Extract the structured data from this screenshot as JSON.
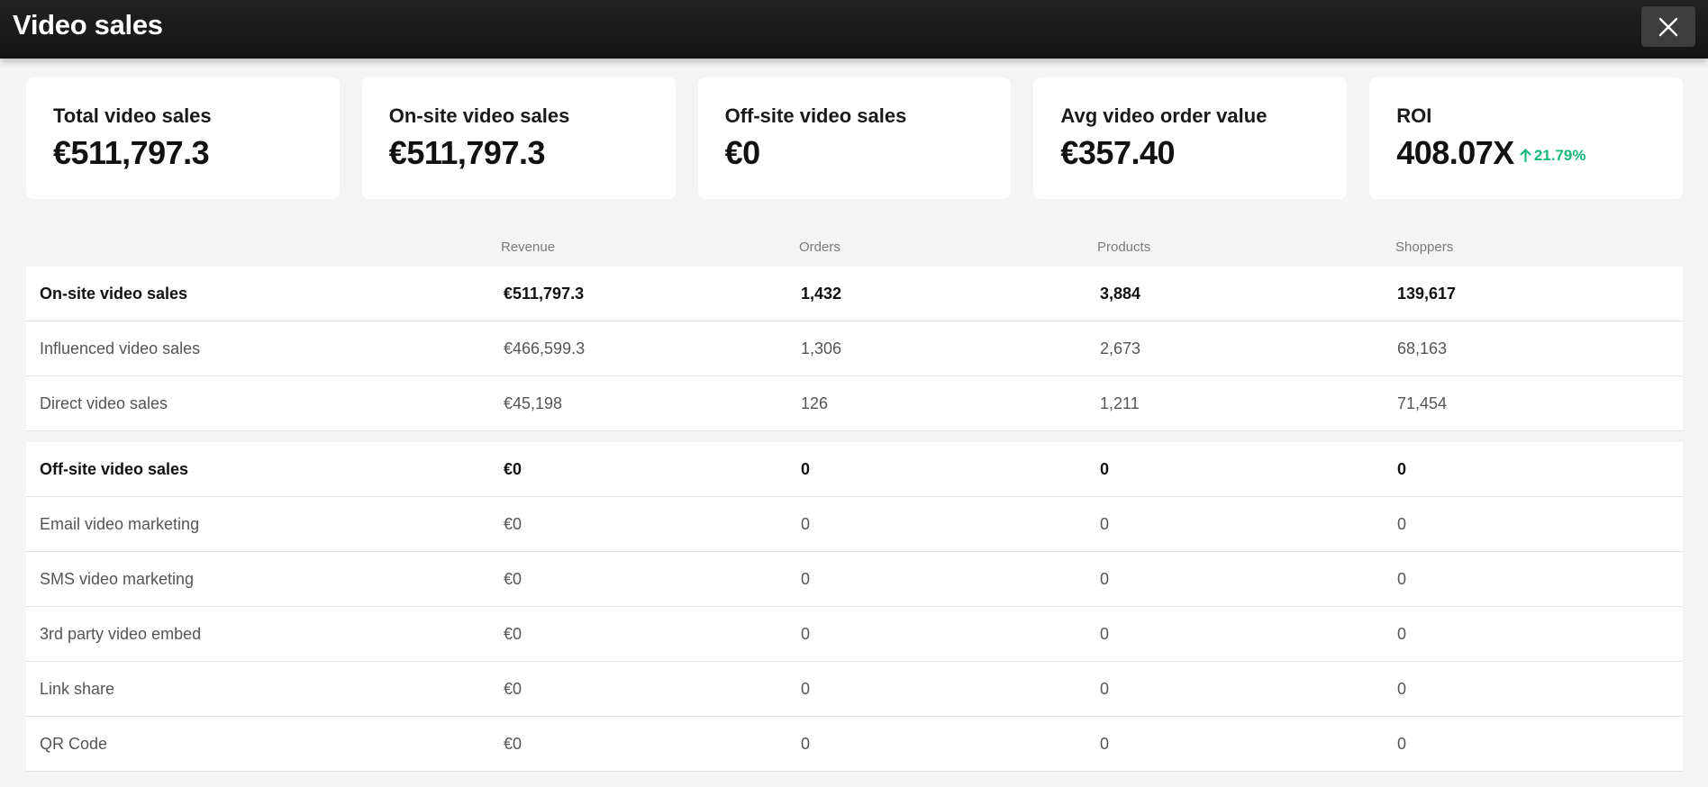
{
  "header": {
    "title": "Video sales"
  },
  "kpis": [
    {
      "label": "Total video sales",
      "value": "€511,797.3"
    },
    {
      "label": "On-site video sales",
      "value": "€511,797.3"
    },
    {
      "label": "Off-site video sales",
      "value": "€0"
    },
    {
      "label": "Avg video order value",
      "value": "€357.40"
    },
    {
      "label": "ROI",
      "value": "408.07X",
      "trend": "21.79%",
      "trend_direction": "up",
      "trend_color": "#1ab87a"
    }
  ],
  "table": {
    "columns": [
      "Revenue",
      "Orders",
      "Products",
      "Shoppers"
    ],
    "onsite": [
      {
        "name": "On-site video sales",
        "revenue": "€511,797.3",
        "orders": "1,432",
        "products": "3,884",
        "shoppers": "139,617"
      },
      {
        "name": "Influenced video sales",
        "revenue": "€466,599.3",
        "orders": "1,306",
        "products": "2,673",
        "shoppers": "68,163"
      },
      {
        "name": "Direct video sales",
        "revenue": "€45,198",
        "orders": "126",
        "products": "1,211",
        "shoppers": "71,454"
      }
    ],
    "offsite": [
      {
        "name": "Off-site video sales",
        "revenue": "€0",
        "orders": "0",
        "products": "0",
        "shoppers": "0"
      },
      {
        "name": "Email video marketing",
        "revenue": "€0",
        "orders": "0",
        "products": "0",
        "shoppers": "0"
      },
      {
        "name": "SMS video marketing",
        "revenue": "€0",
        "orders": "0",
        "products": "0",
        "shoppers": "0"
      },
      {
        "name": "3rd party video embed",
        "revenue": "€0",
        "orders": "0",
        "products": "0",
        "shoppers": "0"
      },
      {
        "name": "Link share",
        "revenue": "€0",
        "orders": "0",
        "products": "0",
        "shoppers": "0"
      },
      {
        "name": "QR Code",
        "revenue": "€0",
        "orders": "0",
        "products": "0",
        "shoppers": "0"
      }
    ]
  }
}
